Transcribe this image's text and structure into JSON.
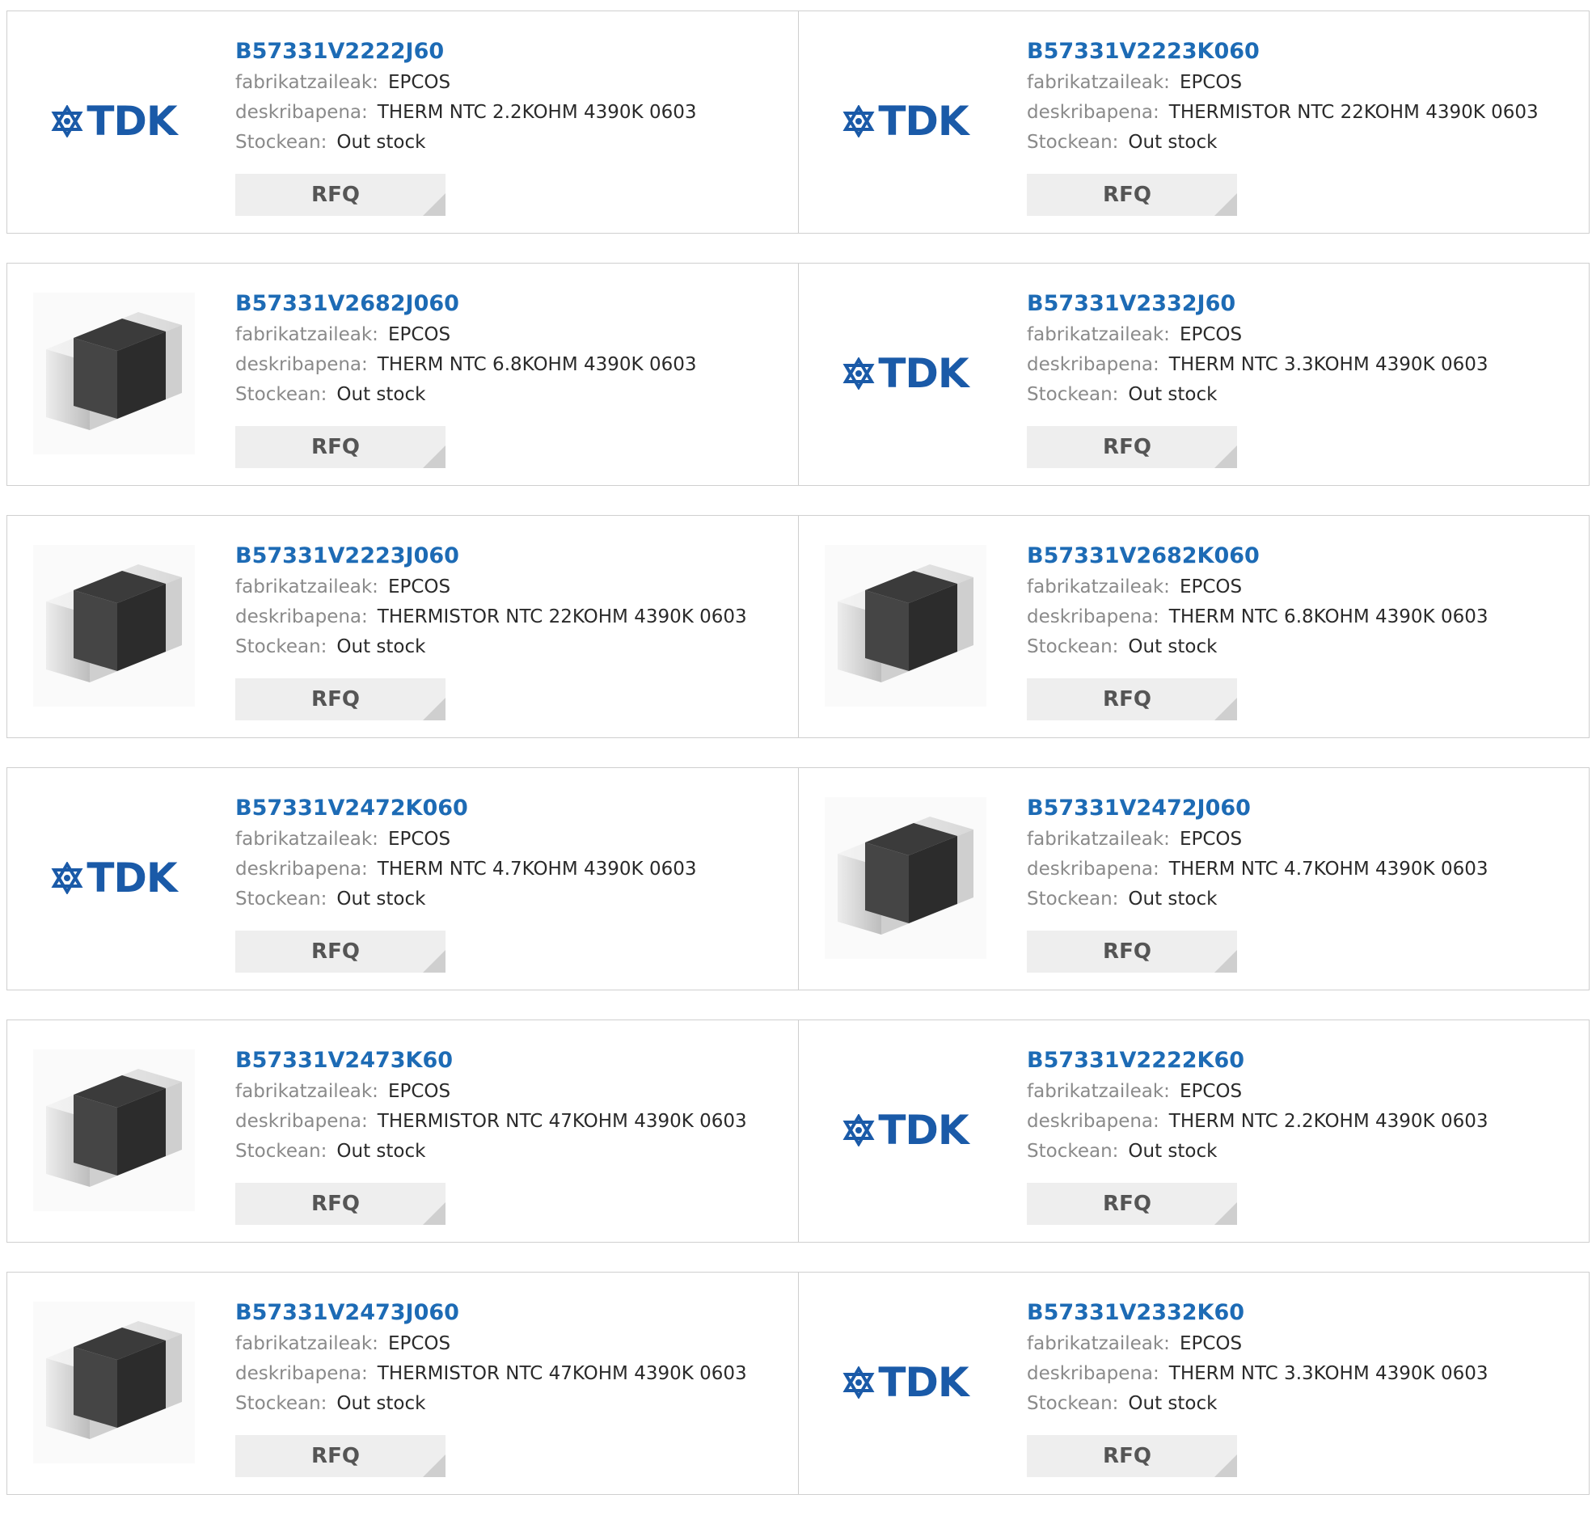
{
  "products": [
    {
      "part": "B57331V2222J60",
      "manufacturer_label": "fabrikatzaileak:",
      "manufacturer": "EPCOS",
      "description_label": "deskribapena:",
      "description": "THERM NTC 2.2KOHM 4390K 0603",
      "stock_label": "Stockean:",
      "stock": "Out stock",
      "rfq_label": "RFQ",
      "image": "tdk-logo"
    },
    {
      "part": "B57331V2223K060",
      "manufacturer_label": "fabrikatzaileak:",
      "manufacturer": "EPCOS",
      "description_label": "deskribapena:",
      "description": "THERMISTOR NTC 22KOHM 4390K 0603",
      "stock_label": "Stockean:",
      "stock": "Out stock",
      "rfq_label": "RFQ",
      "image": "tdk-logo"
    },
    {
      "part": "B57331V2682J060",
      "manufacturer_label": "fabrikatzaileak:",
      "manufacturer": "EPCOS",
      "description_label": "deskribapena:",
      "description": "THERM NTC 6.8KOHM 4390K 0603",
      "stock_label": "Stockean:",
      "stock": "Out stock",
      "rfq_label": "RFQ",
      "image": "chip"
    },
    {
      "part": "B57331V2332J60",
      "manufacturer_label": "fabrikatzaileak:",
      "manufacturer": "EPCOS",
      "description_label": "deskribapena:",
      "description": "THERM NTC 3.3KOHM 4390K 0603",
      "stock_label": "Stockean:",
      "stock": "Out stock",
      "rfq_label": "RFQ",
      "image": "tdk-logo"
    },
    {
      "part": "B57331V2223J060",
      "manufacturer_label": "fabrikatzaileak:",
      "manufacturer": "EPCOS",
      "description_label": "deskribapena:",
      "description": "THERMISTOR NTC 22KOHM 4390K 0603",
      "stock_label": "Stockean:",
      "stock": "Out stock",
      "rfq_label": "RFQ",
      "image": "chip"
    },
    {
      "part": "B57331V2682K060",
      "manufacturer_label": "fabrikatzaileak:",
      "manufacturer": "EPCOS",
      "description_label": "deskribapena:",
      "description": "THERM NTC 6.8KOHM 4390K 0603",
      "stock_label": "Stockean:",
      "stock": "Out stock",
      "rfq_label": "RFQ",
      "image": "chip"
    },
    {
      "part": "B57331V2472K060",
      "manufacturer_label": "fabrikatzaileak:",
      "manufacturer": "EPCOS",
      "description_label": "deskribapena:",
      "description": "THERM NTC 4.7KOHM 4390K 0603",
      "stock_label": "Stockean:",
      "stock": "Out stock",
      "rfq_label": "RFQ",
      "image": "tdk-logo"
    },
    {
      "part": "B57331V2472J060",
      "manufacturer_label": "fabrikatzaileak:",
      "manufacturer": "EPCOS",
      "description_label": "deskribapena:",
      "description": "THERM NTC 4.7KOHM 4390K 0603",
      "stock_label": "Stockean:",
      "stock": "Out stock",
      "rfq_label": "RFQ",
      "image": "chip"
    },
    {
      "part": "B57331V2473K60",
      "manufacturer_label": "fabrikatzaileak:",
      "manufacturer": "EPCOS",
      "description_label": "deskribapena:",
      "description": "THERMISTOR NTC 47KOHM 4390K 0603",
      "stock_label": "Stockean:",
      "stock": "Out stock",
      "rfq_label": "RFQ",
      "image": "chip"
    },
    {
      "part": "B57331V2222K60",
      "manufacturer_label": "fabrikatzaileak:",
      "manufacturer": "EPCOS",
      "description_label": "deskribapena:",
      "description": "THERM NTC 2.2KOHM 4390K 0603",
      "stock_label": "Stockean:",
      "stock": "Out stock",
      "rfq_label": "RFQ",
      "image": "tdk-logo"
    },
    {
      "part": "B57331V2473J060",
      "manufacturer_label": "fabrikatzaileak:",
      "manufacturer": "EPCOS",
      "description_label": "deskribapena:",
      "description": "THERMISTOR NTC 47KOHM 4390K 0603",
      "stock_label": "Stockean:",
      "stock": "Out stock",
      "rfq_label": "RFQ",
      "image": "chip"
    },
    {
      "part": "B57331V2332K60",
      "manufacturer_label": "fabrikatzaileak:",
      "manufacturer": "EPCOS",
      "description_label": "deskribapena:",
      "description": "THERM NTC 3.3KOHM 4390K 0603",
      "stock_label": "Stockean:",
      "stock": "Out stock",
      "rfq_label": "RFQ",
      "image": "tdk-logo"
    }
  ],
  "logo": {
    "text": "TDK",
    "color": "#1a5aa8"
  },
  "colors": {
    "part_link": "#1d6bb5",
    "label": "#8a8a8a",
    "rfq_bg": "#eeeeee",
    "border": "#cfcfcf"
  }
}
